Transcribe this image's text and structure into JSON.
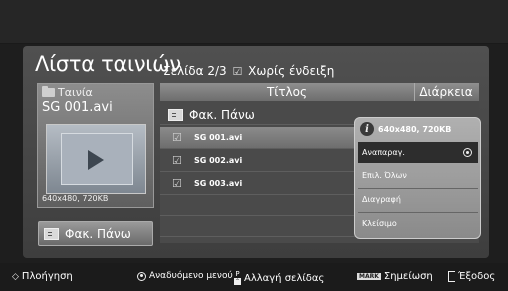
{
  "screen": {
    "title": "Λίστα ταινιών",
    "page_label": "Σελίδα",
    "page_value": "2/3",
    "mark_indicator": "☑",
    "mark_status": "Χωρίς ένδειξη"
  },
  "preview": {
    "category": "Ταινία",
    "file_name": "SG 001.avi",
    "resolution": "640x480, 720KB",
    "up_folder_label": "Φακ. Πάνω"
  },
  "table": {
    "col_title": "Τίτλος",
    "col_duration": "Διάρκεια",
    "folder_label": "Φακ. Πάνω",
    "files": [
      {
        "check": "☑",
        "name": "SG 001.avi"
      },
      {
        "check": "☑",
        "name": "SG 002.avi"
      },
      {
        "check": "☑",
        "name": "SG 003.avi"
      }
    ]
  },
  "popup": {
    "info": "640x480, 720KB",
    "items": [
      "Αναπαραγ.",
      "Επιλ. Όλων",
      "Διαγραφή",
      "Κλείσιμο"
    ]
  },
  "bottom": {
    "navigate": "Πλοήγηση",
    "popup_menu": "Αναδυόμενο μενού",
    "page_change": "Αλλαγή σελίδας",
    "mark_key": "MARK",
    "mark": "Σημείωση",
    "exit": "Έξοδος"
  }
}
